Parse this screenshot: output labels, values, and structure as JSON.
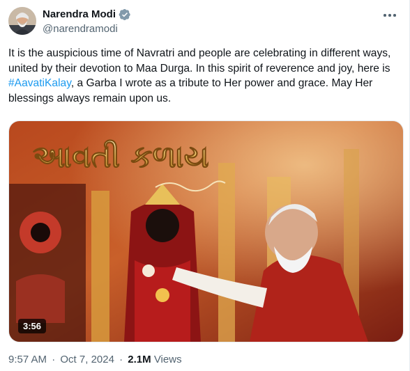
{
  "author": {
    "name": "Narendra Modi",
    "handle": "@narendramodi"
  },
  "tweet": {
    "text_before": "It is the auspicious time of Navratri and people are celebrating in different ways, united by their devotion to Maa Durga. In this spirit of reverence and joy, here is ",
    "hashtag": "#AavatiKalay",
    "text_after": ", a Garba I wrote as a tribute to Her power and grace. May Her blessings always remain upon us."
  },
  "media": {
    "title": "આવતી કળાય",
    "duration": "3:56"
  },
  "meta": {
    "time": "9:57 AM",
    "separator": "·",
    "date": "Oct 7, 2024",
    "views_count": "2.1M",
    "views_label": "Views"
  },
  "colors": {
    "accent": "#1d9bf0",
    "secondary_text": "#536471",
    "primary_text": "#0f1419"
  },
  "icons": {
    "verified": "verified-badge-icon",
    "more": "more-options-icon"
  }
}
